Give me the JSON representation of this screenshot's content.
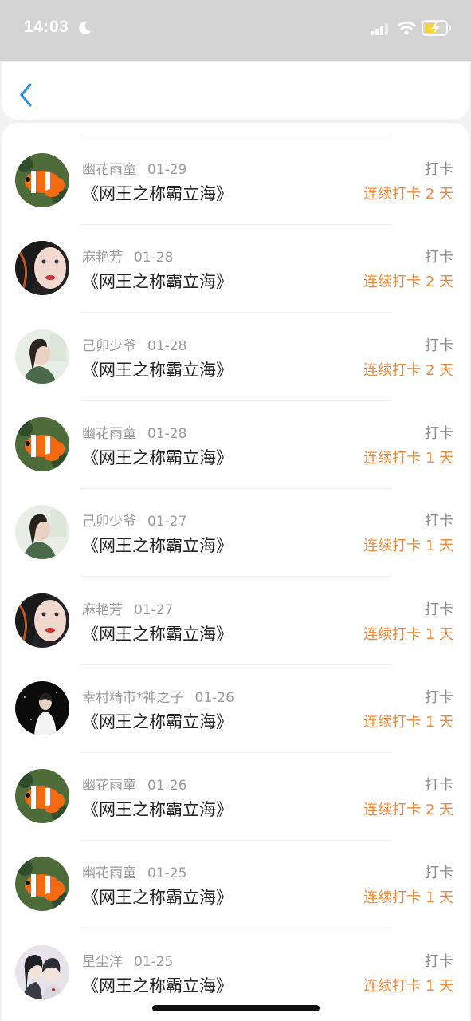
{
  "status_bar": {
    "time": "14:03"
  },
  "checkin_label": "打卡",
  "rows": [
    {
      "name": "幽花雨童",
      "date": "01-29",
      "book": "《网王之称霸立海》",
      "checkin": "打卡",
      "streak": "连续打卡 2 天",
      "avatar": "clownfish"
    },
    {
      "name": "麻艳芳",
      "date": "01-28",
      "book": "《网王之称霸立海》",
      "checkin": "打卡",
      "streak": "连续打卡 2 天",
      "avatar": "face"
    },
    {
      "name": "己卯少爷",
      "date": "01-28",
      "book": "《网王之称霸立海》",
      "checkin": "打卡",
      "streak": "连续打卡 2 天",
      "avatar": "girl"
    },
    {
      "name": "幽花雨童",
      "date": "01-28",
      "book": "《网王之称霸立海》",
      "checkin": "打卡",
      "streak": "连续打卡 1 天",
      "avatar": "clownfish"
    },
    {
      "name": "己卯少爷",
      "date": "01-27",
      "book": "《网王之称霸立海》",
      "checkin": "打卡",
      "streak": "连续打卡 1 天",
      "avatar": "girl"
    },
    {
      "name": "麻艳芳",
      "date": "01-27",
      "book": "《网王之称霸立海》",
      "checkin": "打卡",
      "streak": "连续打卡 1 天",
      "avatar": "face"
    },
    {
      "name": "幸村精市*神之子",
      "date": "01-26",
      "book": "《网王之称霸立海》",
      "checkin": "打卡",
      "streak": "连续打卡 1 天",
      "avatar": "dark"
    },
    {
      "name": "幽花雨童",
      "date": "01-26",
      "book": "《网王之称霸立海》",
      "checkin": "打卡",
      "streak": "连续打卡 2 天",
      "avatar": "clownfish"
    },
    {
      "name": "幽花雨童",
      "date": "01-25",
      "book": "《网王之称霸立海》",
      "checkin": "打卡",
      "streak": "连续打卡 1 天",
      "avatar": "clownfish"
    },
    {
      "name": "星尘洋",
      "date": "01-25",
      "book": "《网王之称霸立海》",
      "checkin": "打卡",
      "streak": "连续打卡 1 天",
      "avatar": "anime"
    }
  ],
  "colors": {
    "accent": "#f0883a",
    "back": "#2b8fe0"
  }
}
